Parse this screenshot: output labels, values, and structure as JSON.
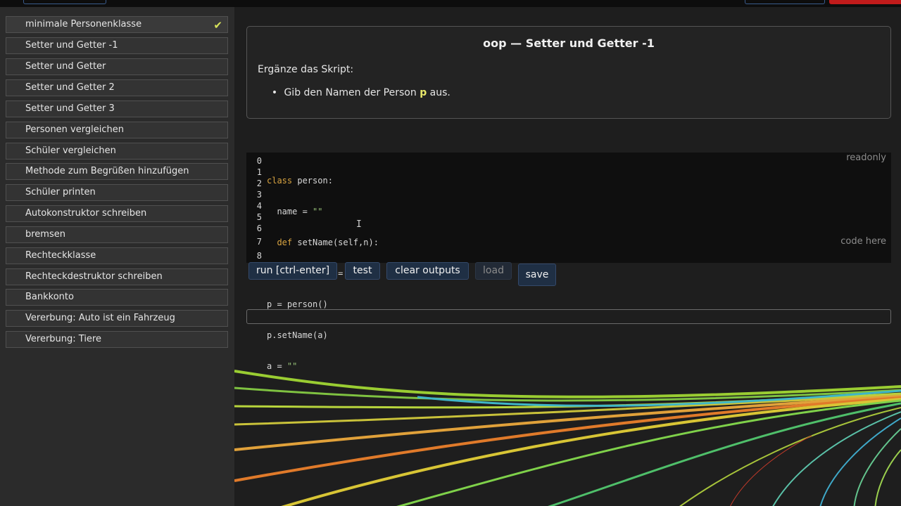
{
  "sidebar": {
    "items": [
      {
        "label": "minimale Personenklasse",
        "done": true
      },
      {
        "label": "Setter und Getter -1"
      },
      {
        "label": "Setter und Getter"
      },
      {
        "label": "Setter und Getter 2"
      },
      {
        "label": "Setter und Getter 3"
      },
      {
        "label": "Personen vergleichen"
      },
      {
        "label": "Schüler vergleichen"
      },
      {
        "label": "Methode zum Begrüßen hinzufügen"
      },
      {
        "label": "Schüler printen"
      },
      {
        "label": "Autokonstruktor schreiben"
      },
      {
        "label": "bremsen"
      },
      {
        "label": "Rechteckklasse"
      },
      {
        "label": "Rechteckdestruktor schreiben"
      },
      {
        "label": "Bankkonto"
      },
      {
        "label": "Vererbung: Auto ist ein Fahrzeug"
      },
      {
        "label": "Vererbung: Tiere"
      }
    ],
    "check_glyph": "✔"
  },
  "task": {
    "title": "oop — Setter und Getter -1",
    "intro": "Ergänze das Skript:",
    "bullet_prefix": "Gib den Namen der Person",
    "bullet_var": "p",
    "bullet_suffix": "aus."
  },
  "editor": {
    "readonly_label": "readonly",
    "code_here_label": "code here",
    "line_numbers": [
      "0",
      "1",
      "2",
      "3",
      "4",
      "5",
      "6",
      "7",
      "8"
    ],
    "lines": [
      "class person:",
      "  name = \"\"",
      "  def setName(self,n):",
      "    self.name = n",
      "p = person()",
      "p.setName(a)",
      "a = \"\""
    ]
  },
  "buttons": {
    "run": "run [ctrl-enter]",
    "test": "test",
    "clear": "clear outputs",
    "load": "load",
    "save": "save"
  },
  "output": {
    "value": ""
  },
  "colors": {
    "accent_check": "#d7e35a",
    "keyword": "#d9a441",
    "string": "#98c379",
    "button_bg": "#1f2f44"
  }
}
